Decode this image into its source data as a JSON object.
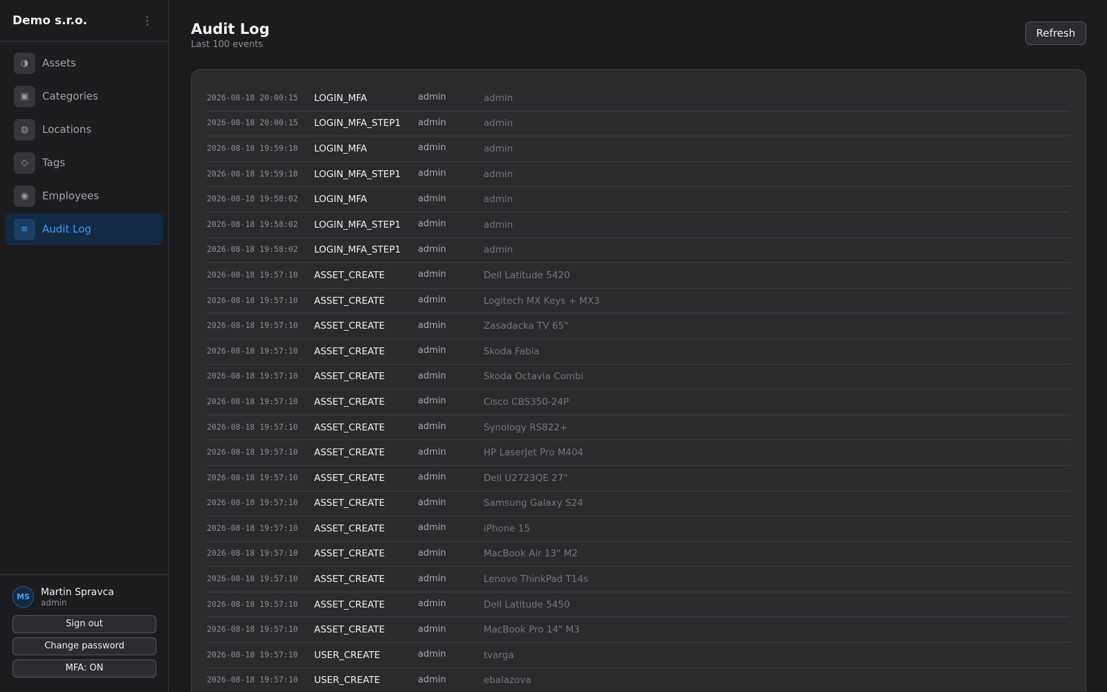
{
  "sidebar": {
    "brand": "Demo s.r.o.",
    "menu_icon": "⋮",
    "items": [
      {
        "label": "Assets",
        "icon": "◑",
        "icon_name": "assets-icon",
        "active": false
      },
      {
        "label": "Categories",
        "icon": "▣",
        "icon_name": "categories-icon",
        "active": false
      },
      {
        "label": "Locations",
        "icon": "◍",
        "icon_name": "locations-icon",
        "active": false
      },
      {
        "label": "Tags",
        "icon": "◇",
        "icon_name": "tags-icon",
        "active": false
      },
      {
        "label": "Employees",
        "icon": "◉",
        "icon_name": "employees-icon",
        "active": false
      },
      {
        "label": "Audit Log",
        "icon": "≡",
        "icon_name": "audit-log-icon",
        "active": true
      }
    ],
    "user": {
      "initials": "MS",
      "name": "Martin Spravca",
      "role": "admin"
    },
    "buttons": {
      "sign_out": "Sign out",
      "change_password": "Change password",
      "mfa": "MFA: ON"
    }
  },
  "header": {
    "title": "Audit Log",
    "subtitle": "Last 100 events",
    "refresh_label": "Refresh"
  },
  "log": {
    "rows": [
      {
        "time": "2026-08-18 20:00:15",
        "event": "LOGIN_MFA",
        "user": "admin",
        "target": "admin"
      },
      {
        "time": "2026-08-18 20:00:15",
        "event": "LOGIN_MFA_STEP1",
        "user": "admin",
        "target": "admin"
      },
      {
        "time": "2026-08-18 19:59:18",
        "event": "LOGIN_MFA",
        "user": "admin",
        "target": "admin"
      },
      {
        "time": "2026-08-18 19:59:18",
        "event": "LOGIN_MFA_STEP1",
        "user": "admin",
        "target": "admin"
      },
      {
        "time": "2026-08-18 19:58:02",
        "event": "LOGIN_MFA",
        "user": "admin",
        "target": "admin"
      },
      {
        "time": "2026-08-18 19:58:02",
        "event": "LOGIN_MFA_STEP1",
        "user": "admin",
        "target": "admin"
      },
      {
        "time": "2026-08-18 19:58:02",
        "event": "LOGIN_MFA_STEP1",
        "user": "admin",
        "target": "admin"
      },
      {
        "time": "2026-08-18 19:57:10",
        "event": "ASSET_CREATE",
        "user": "admin",
        "target": "Dell Latitude 5420"
      },
      {
        "time": "2026-08-18 19:57:10",
        "event": "ASSET_CREATE",
        "user": "admin",
        "target": "Logitech MX Keys + MX3"
      },
      {
        "time": "2026-08-18 19:57:10",
        "event": "ASSET_CREATE",
        "user": "admin",
        "target": "Zasadacka TV 65\""
      },
      {
        "time": "2026-08-18 19:57:10",
        "event": "ASSET_CREATE",
        "user": "admin",
        "target": "Skoda Fabia"
      },
      {
        "time": "2026-08-18 19:57:10",
        "event": "ASSET_CREATE",
        "user": "admin",
        "target": "Skoda Octavia Combi"
      },
      {
        "time": "2026-08-18 19:57:10",
        "event": "ASSET_CREATE",
        "user": "admin",
        "target": "Cisco CBS350-24P"
      },
      {
        "time": "2026-08-18 19:57:10",
        "event": "ASSET_CREATE",
        "user": "admin",
        "target": "Synology RS822+"
      },
      {
        "time": "2026-08-18 19:57:10",
        "event": "ASSET_CREATE",
        "user": "admin",
        "target": "HP LaserJet Pro M404"
      },
      {
        "time": "2026-08-18 19:57:10",
        "event": "ASSET_CREATE",
        "user": "admin",
        "target": "Dell U2723QE 27\""
      },
      {
        "time": "2026-08-18 19:57:10",
        "event": "ASSET_CREATE",
        "user": "admin",
        "target": "Samsung Galaxy S24"
      },
      {
        "time": "2026-08-18 19:57:10",
        "event": "ASSET_CREATE",
        "user": "admin",
        "target": "iPhone 15"
      },
      {
        "time": "2026-08-18 19:57:10",
        "event": "ASSET_CREATE",
        "user": "admin",
        "target": "MacBook Air 13\" M2"
      },
      {
        "time": "2026-08-18 19:57:10",
        "event": "ASSET_CREATE",
        "user": "admin",
        "target": "Lenovo ThinkPad T14s"
      },
      {
        "time": "2026-08-18 19:57:10",
        "event": "ASSET_CREATE",
        "user": "admin",
        "target": "Dell Latitude 5450"
      },
      {
        "time": "2026-08-18 19:57:10",
        "event": "ASSET_CREATE",
        "user": "admin",
        "target": "MacBook Pro 14\" M3"
      },
      {
        "time": "2026-08-18 19:57:10",
        "event": "USER_CREATE",
        "user": "admin",
        "target": "tvarga"
      },
      {
        "time": "2026-08-18 19:57:10",
        "event": "USER_CREATE",
        "user": "admin",
        "target": "ebalazova"
      }
    ]
  },
  "colors": {
    "accent": "#3d9bf5",
    "background": "#1c1c1e",
    "card": "#2b2b2e"
  }
}
